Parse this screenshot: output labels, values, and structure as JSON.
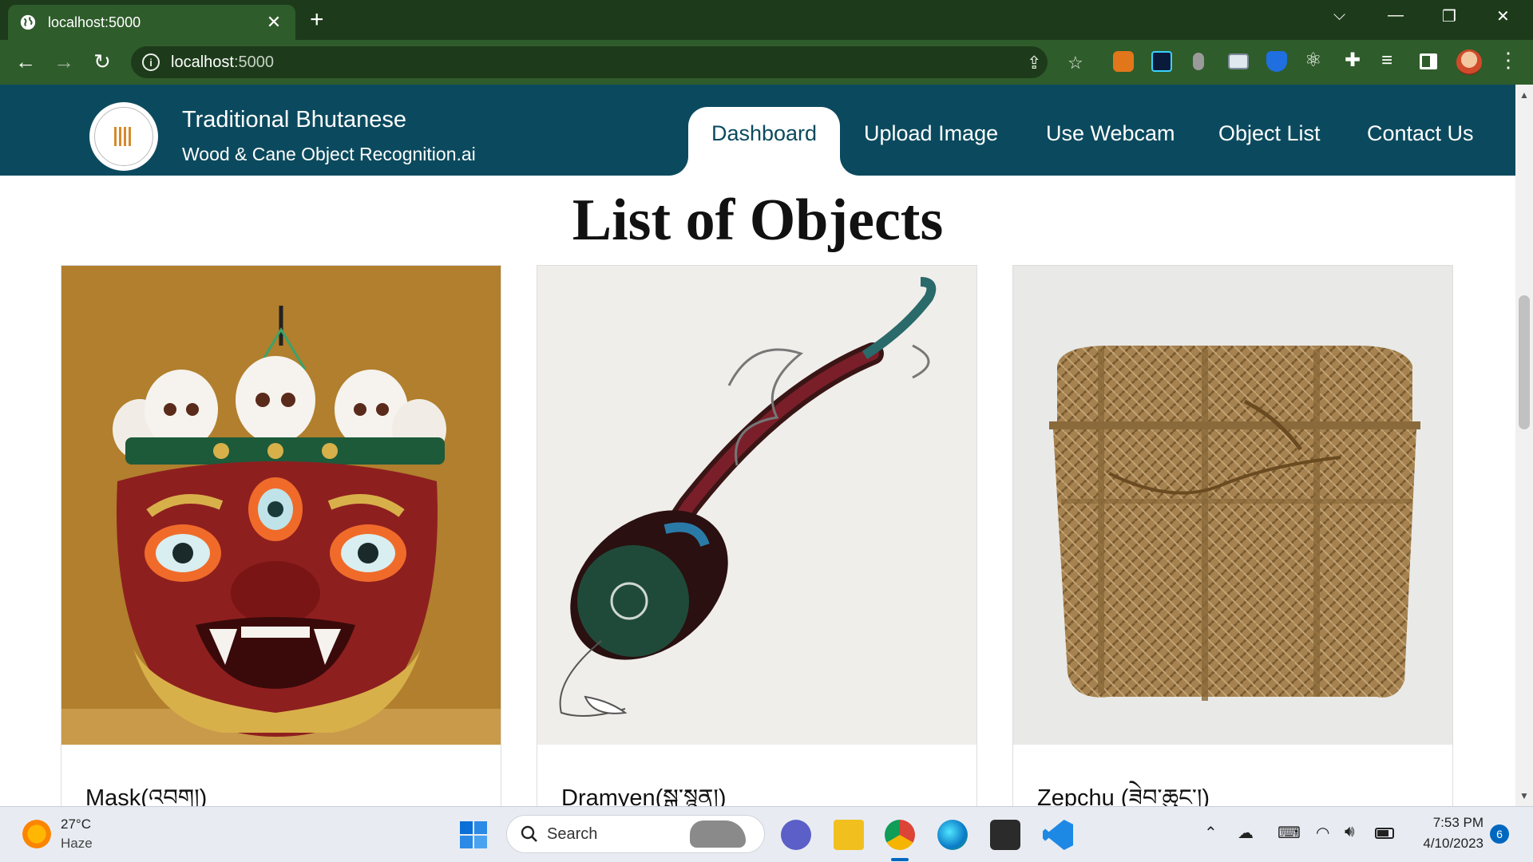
{
  "browser": {
    "tab_title": "localhost:5000",
    "tab_close": "✕",
    "new_tab": "+",
    "url_host": "localhost",
    "url_port": ":5000",
    "win_minimize": "—",
    "win_restore": "❐",
    "win_close": "✕",
    "win_tabsearch": "⌵",
    "back": "←",
    "forward": "→",
    "reload": "↻",
    "share": "⇪",
    "star": "☆",
    "puzzle": "✚",
    "kebab": "⋮",
    "accent": "#2f5c2b"
  },
  "site": {
    "title": "Traditional Bhutanese",
    "subtitle": "Wood & Cane Object Recognition.ai",
    "header_color": "#0b4a5e",
    "nav": [
      {
        "label": "Dashboard",
        "active": true
      },
      {
        "label": "Upload Image"
      },
      {
        "label": "Use Webcam"
      },
      {
        "label": "Object List"
      },
      {
        "label": "Contact Us"
      }
    ]
  },
  "page": {
    "heading": "List of Objects",
    "cards": [
      {
        "title": "Mask(འབག།)"
      },
      {
        "title": "Dramyen(སྒྲ་སྙན།)"
      },
      {
        "title": "Zepchu (ཟེབ་ཆུང་།)"
      }
    ]
  },
  "taskbar": {
    "temperature": "27°C",
    "weather": "Haze",
    "search_label": "Search",
    "time": "7:53 PM",
    "date": "4/10/2023",
    "notifications": "6",
    "tray_up": "⌃",
    "tray_volume": "🔊︎"
  }
}
